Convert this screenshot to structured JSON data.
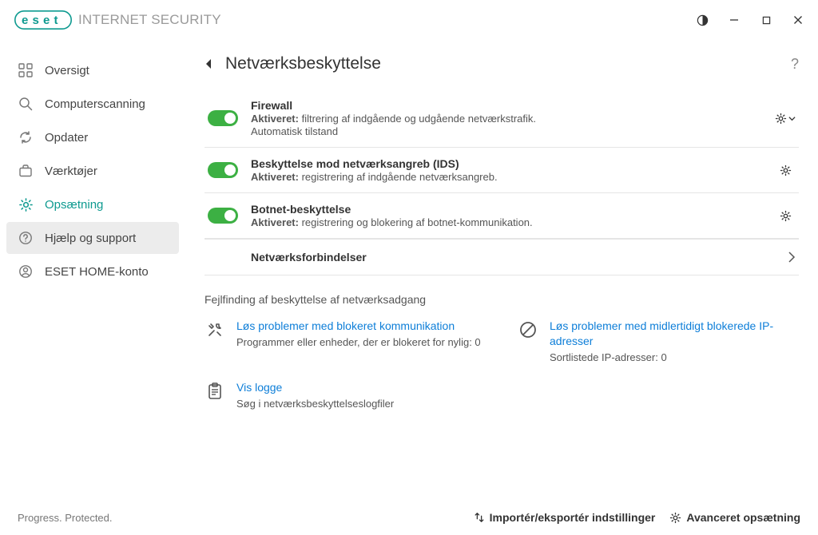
{
  "brand": {
    "name": "eset",
    "product": "INTERNET SECURITY"
  },
  "sidebar": {
    "items": [
      {
        "label": "Oversigt"
      },
      {
        "label": "Computerscanning"
      },
      {
        "label": "Opdater"
      },
      {
        "label": "Værktøjer"
      },
      {
        "label": "Opsætning"
      },
      {
        "label": "Hjælp og support"
      },
      {
        "label": "ESET HOME-konto"
      }
    ]
  },
  "page": {
    "title": "Netværksbeskyttelse"
  },
  "protections": [
    {
      "title": "Firewall",
      "status_label": "Aktiveret:",
      "status_text": "filtrering af indgående og udgående netværkstrafik.",
      "sub": "Automatisk tilstand"
    },
    {
      "title": "Beskyttelse mod netværksangreb (IDS)",
      "status_label": "Aktiveret:",
      "status_text": "registrering af indgående netværksangreb."
    },
    {
      "title": "Botnet-beskyttelse",
      "status_label": "Aktiveret:",
      "status_text": "registrering og blokering af botnet-kommunikation."
    }
  ],
  "connections_row": {
    "title": "Netværksforbindelser"
  },
  "troubleshoot": {
    "heading": "Fejlfinding af beskyttelse af netværksadgang",
    "items": [
      {
        "link": "Løs problemer med blokeret kommunikation",
        "desc": "Programmer eller enheder, der er blokeret for nylig: 0"
      },
      {
        "link": "Løs problemer med midlertidigt blokerede IP-adresser",
        "desc": "Sortlistede IP-adresser: 0"
      },
      {
        "link": "Vis logge",
        "desc": "Søg i netværksbeskyttelseslogfiler"
      }
    ]
  },
  "footer": {
    "tagline": "Progress. Protected.",
    "import_export": "Importér/eksportér indstillinger",
    "advanced": "Avanceret opsætning"
  }
}
